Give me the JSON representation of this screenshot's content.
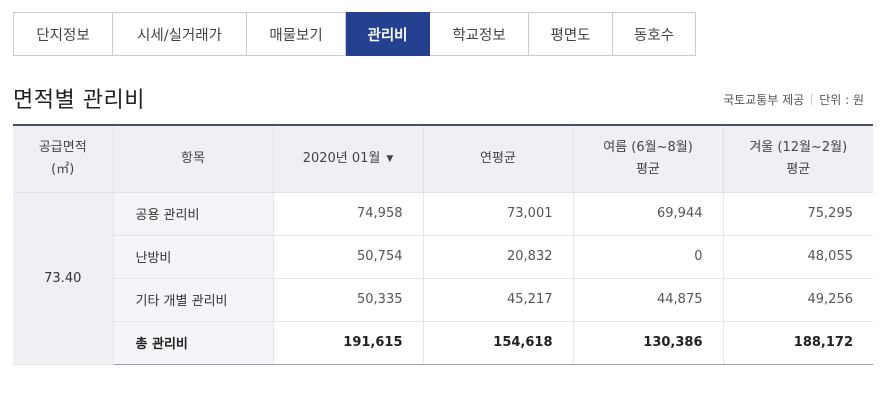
{
  "tabs": [
    {
      "label": "단지정보",
      "active": false
    },
    {
      "label": "시세/실거래가",
      "active": false
    },
    {
      "label": "매물보기",
      "active": false
    },
    {
      "label": "관리비",
      "active": true
    },
    {
      "label": "학교정보",
      "active": false
    },
    {
      "label": "평면도",
      "active": false
    },
    {
      "label": "동호수",
      "active": false
    }
  ],
  "section": {
    "title": "면적별 관리비",
    "source": "국토교통부 제공",
    "unit": "단위 : 원"
  },
  "table": {
    "headers": {
      "area_line1": "공급면적",
      "area_line2": "(㎡)",
      "item": "항목",
      "month": "2020년 01월",
      "yearly": "연평균",
      "summer_line1": "여름 (6월~8월)",
      "summer_line2": "평균",
      "winter_line1": "겨울 (12월~2월)",
      "winter_line2": "평균"
    },
    "area": "73.40",
    "rows": [
      {
        "item": "공용 관리비",
        "month": "74,958",
        "yearly": "73,001",
        "summer": "69,944",
        "winter": "75,295"
      },
      {
        "item": "난방비",
        "month": "50,754",
        "yearly": "20,832",
        "summer": "0",
        "winter": "48,055"
      },
      {
        "item": "기타 개별 관리비",
        "month": "50,335",
        "yearly": "45,217",
        "summer": "44,875",
        "winter": "49,256"
      },
      {
        "item": "총 관리비",
        "month": "191,615",
        "yearly": "154,618",
        "summer": "130,386",
        "winter": "188,172"
      }
    ]
  },
  "colors": {
    "active_tab": "#23418e",
    "header_bg": "#eef0f6"
  }
}
